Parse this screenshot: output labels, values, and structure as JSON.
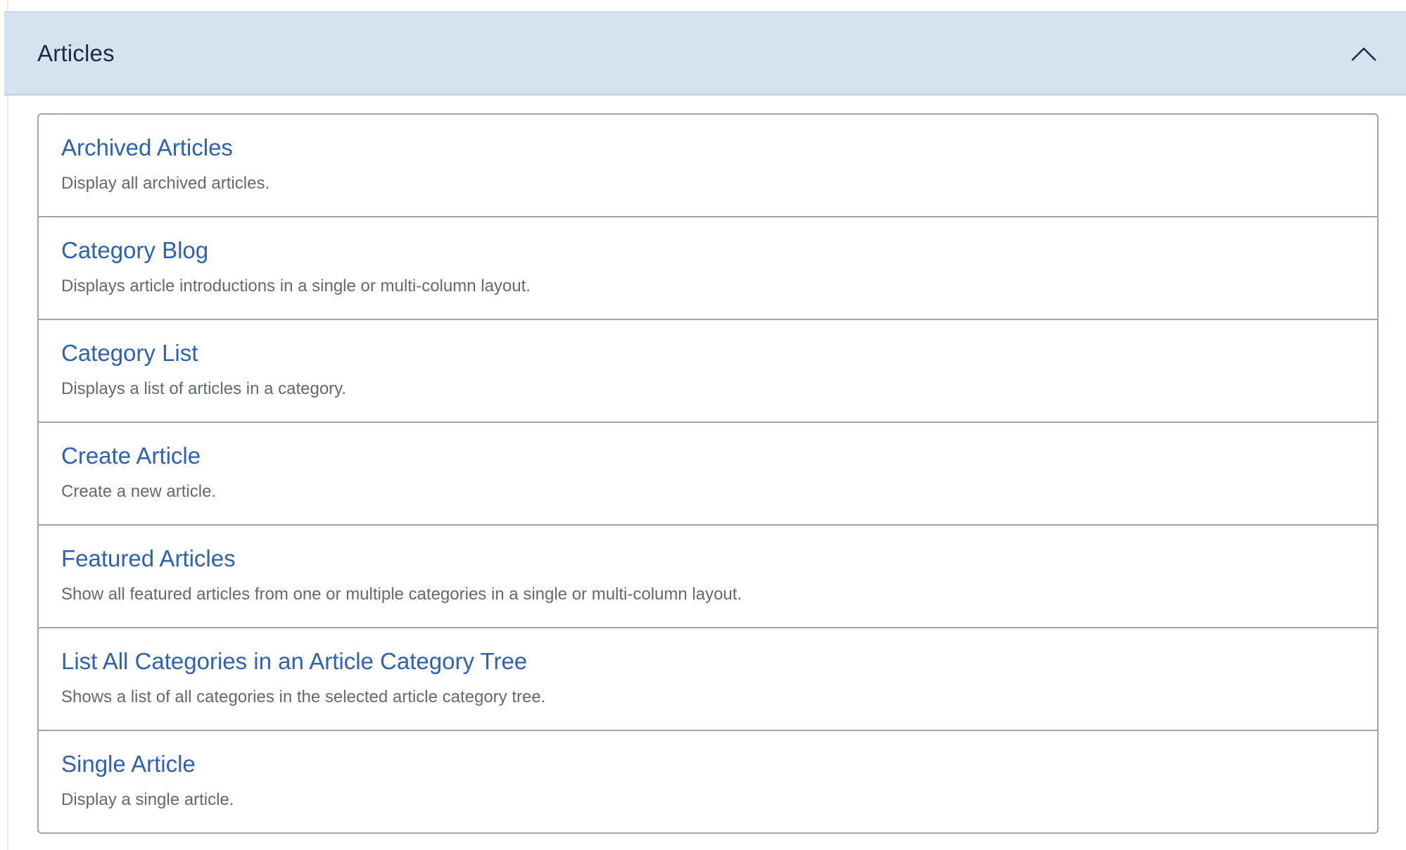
{
  "accordion": {
    "title": "Articles",
    "toggle_icon": "chevron-up-icon",
    "expanded": true
  },
  "items": [
    {
      "title": "Archived Articles",
      "description": "Display all archived articles."
    },
    {
      "title": "Category Blog",
      "description": "Displays article introductions in a single or multi-column layout."
    },
    {
      "title": "Category List",
      "description": "Displays a list of articles in a category."
    },
    {
      "title": "Create Article",
      "description": "Create a new article."
    },
    {
      "title": "Featured Articles",
      "description": "Show all featured articles from one or multiple categories in a single or multi-column layout."
    },
    {
      "title": "List All Categories in an Article Category Tree",
      "description": "Shows a list of all categories in the selected article category tree."
    },
    {
      "title": "Single Article",
      "description": "Display a single article."
    }
  ],
  "colors": {
    "header_bg": "#d6e2f0",
    "link": "#2e62b0",
    "description": "#626970",
    "border": "#9ba6b4"
  }
}
